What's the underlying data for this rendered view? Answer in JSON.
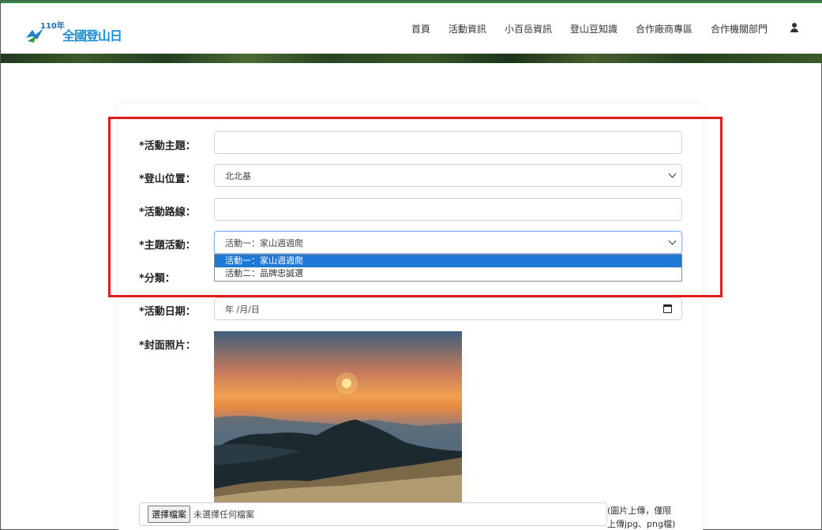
{
  "header": {
    "logo": {
      "year": "110年",
      "text": "全國登山日",
      "highlight": "山"
    },
    "nav": [
      "首頁",
      "活動資訊",
      "小百岳資訊",
      "登山豆知識",
      "合作廠商專區",
      "合作機關部門"
    ]
  },
  "form": {
    "topic_label": "*活動主題：",
    "topic_value": "",
    "location_label": "*登山位置：",
    "location_value": "北北基",
    "route_label": "*活動路線：",
    "route_value": "",
    "theme_label": "*主題活動：",
    "theme_value": "活動一：家山週週爬",
    "theme_options": [
      "活動一：家山週週爬",
      "活動二：品牌忠誠選"
    ],
    "category_label": "*分類：",
    "date_label": "*活動日期：",
    "date_placeholder": "年 /月/日",
    "photo_label": "*封面照片：",
    "file_button": "選擇檔案",
    "file_status": "未選擇任何檔案",
    "file_hint_1": "(圖片上傳，僅限",
    "file_hint_2": "上傳jpg、png檔)"
  }
}
